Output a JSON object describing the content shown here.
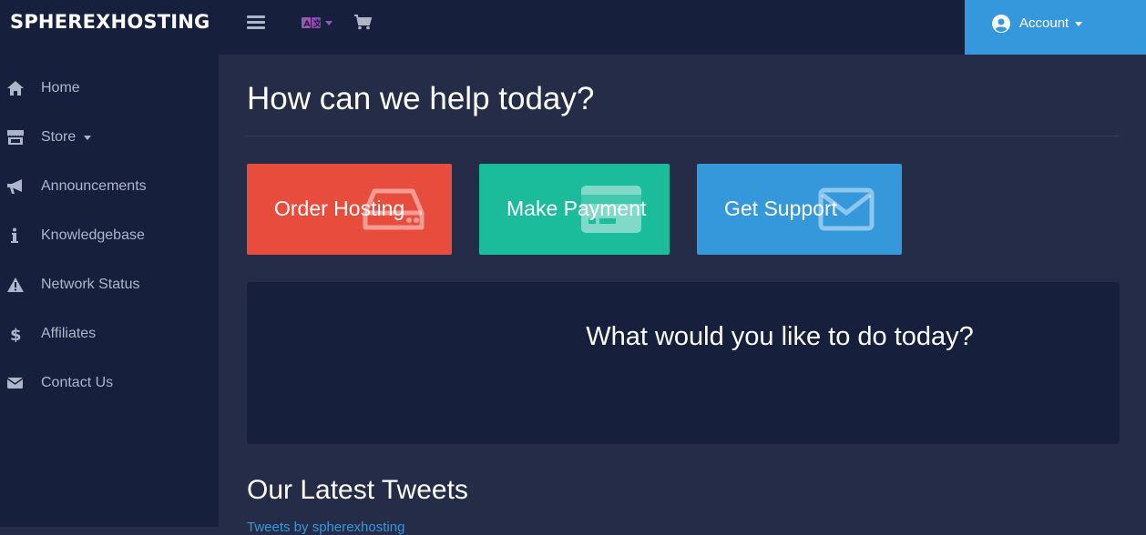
{
  "brand": {
    "name": "SPHEREXHOSTING"
  },
  "header": {
    "account_label": "Account"
  },
  "sidebar": {
    "items": [
      {
        "label": "Home",
        "icon": "home-icon"
      },
      {
        "label": "Store",
        "icon": "store-icon",
        "dropdown": true
      },
      {
        "label": "Announcements",
        "icon": "megaphone-icon"
      },
      {
        "label": "Knowledgebase",
        "icon": "info-icon"
      },
      {
        "label": "Network Status",
        "icon": "warning-icon"
      },
      {
        "label": "Affiliates",
        "icon": "dollar-icon"
      },
      {
        "label": "Contact Us",
        "icon": "envelope-icon"
      }
    ]
  },
  "main": {
    "title": "How can we help today?",
    "tiles": [
      {
        "label": "Order Hosting",
        "icon": "server-icon",
        "color": "#e74c3c"
      },
      {
        "label": "Make Payment",
        "icon": "credit-card-icon",
        "color": "#1abc9c"
      },
      {
        "label": "Get Support",
        "icon": "envelope-icon",
        "color": "#3498db"
      }
    ],
    "panel_title": "What would you like to do today?",
    "tweets_title": "Our Latest Tweets",
    "tweets_link": "Tweets by spherexhosting"
  },
  "colors": {
    "topbar": "#161f3c",
    "background": "#252c47",
    "accent": "#3698dc"
  }
}
